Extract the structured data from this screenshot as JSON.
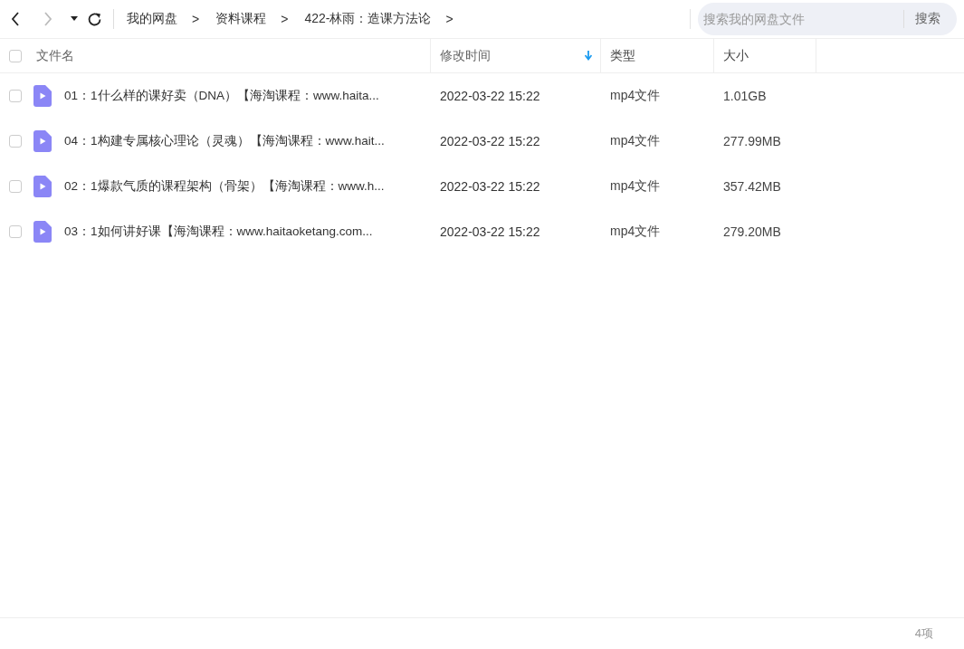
{
  "toolbar": {
    "back": {
      "disabled": false
    },
    "forward": {
      "disabled": true
    },
    "breadcrumbs": [
      "我的网盘",
      "资料课程",
      "422-林雨：造课方法论"
    ],
    "separator": ">",
    "search": {
      "placeholder": "搜索我的网盘文件",
      "button": "搜索"
    }
  },
  "table": {
    "select_all": {
      "checked": false
    },
    "columns": [
      {
        "label": "文件名",
        "sorted": false
      },
      {
        "label": "修改时间",
        "sorted": true
      },
      {
        "label": "类型",
        "sorted": false
      },
      {
        "label": "大小",
        "sorted": false
      }
    ],
    "rows": [
      {
        "name": "01：1什么样的课好卖（DNA）【海淘课程：www.haita...",
        "modified": "2022-03-22 15:22",
        "type": "mp4文件",
        "size": "1.01GB",
        "checked": false
      },
      {
        "name": "04：1构建专属核心理论（灵魂）【海淘课程：www.hait...",
        "modified": "2022-03-22 15:22",
        "type": "mp4文件",
        "size": "277.99MB",
        "checked": false
      },
      {
        "name": "02：1爆款气质的课程架构（骨架）【海淘课程：www.h...",
        "modified": "2022-03-22 15:22",
        "type": "mp4文件",
        "size": "357.42MB",
        "checked": false
      },
      {
        "name": "03：1如何讲好课【海淘课程：www.haitaoketang.com...",
        "modified": "2022-03-22 15:22",
        "type": "mp4文件",
        "size": "279.20MB",
        "checked": false
      }
    ]
  },
  "status_bar": {
    "count": "4项"
  }
}
